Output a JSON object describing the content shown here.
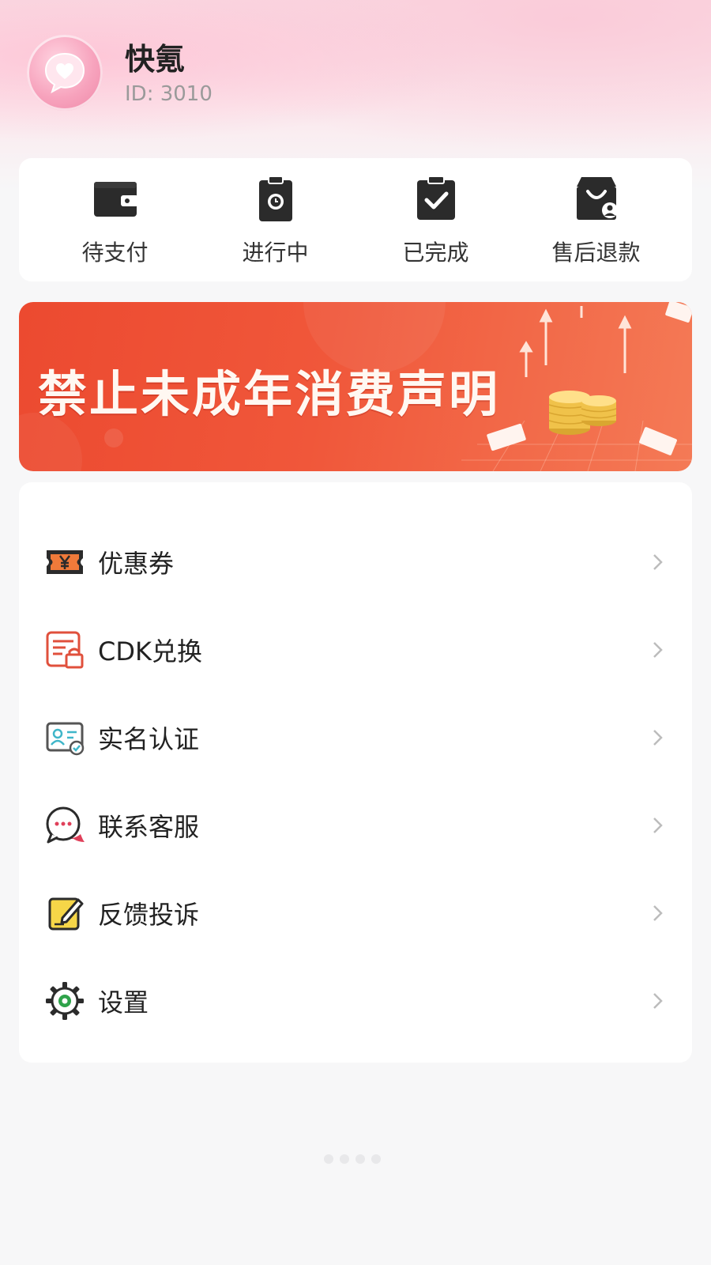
{
  "profile": {
    "username": "快氪",
    "user_id": "ID: 3010"
  },
  "orders": [
    {
      "label": "待支付",
      "icon": "wallet-icon"
    },
    {
      "label": "进行中",
      "icon": "clipboard-clock-icon"
    },
    {
      "label": "已完成",
      "icon": "clipboard-check-icon"
    },
    {
      "label": "售后退款",
      "icon": "shopping-bag-refund-icon"
    }
  ],
  "banner": {
    "text": "禁止未成年消费声明"
  },
  "menu": [
    {
      "label": "优惠券",
      "icon": "coupon-icon"
    },
    {
      "label": "CDK兑换",
      "icon": "cdk-lock-icon"
    },
    {
      "label": "实名认证",
      "icon": "id-card-icon"
    },
    {
      "label": "联系客服",
      "icon": "chat-bubble-icon"
    },
    {
      "label": "反馈投诉",
      "icon": "edit-note-icon"
    },
    {
      "label": "设置",
      "icon": "gear-icon"
    }
  ],
  "colors": {
    "accent_red": "#ec4a30",
    "header_pink": "#f9dbe3",
    "icon_dark": "#2b2b2b"
  }
}
